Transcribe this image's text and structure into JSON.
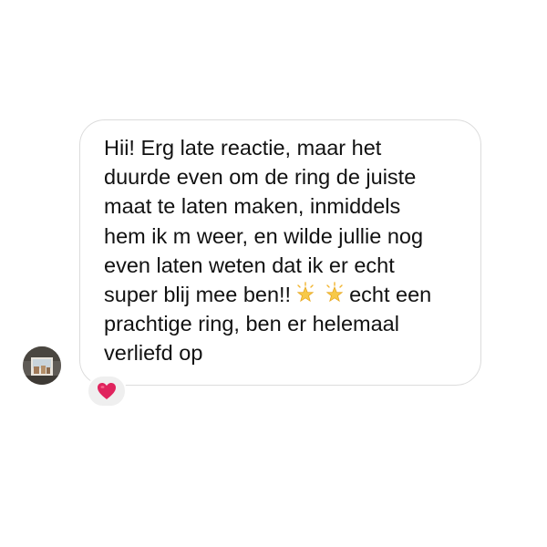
{
  "conversation": {
    "message": {
      "lines": [
        "Hii! Erg late reactie, maar het",
        "duurde even om de ring de juiste",
        "maat te laten maken, inmiddels",
        "hem ik m weer, en wilde jullie nog",
        "even laten weten dat ik er echt"
      ],
      "line6_text_before": "super blij mee ben!!",
      "line6_text_after": "echt een",
      "line7": "prachtige ring, ben er helemaal",
      "line8": "verliefd op",
      "emoji": [
        "star-emoji",
        "star-emoji"
      ]
    },
    "reaction": {
      "emoji": "heart-emoji",
      "color": "#e0245e"
    },
    "sender_avatar_icon": "avatar-photo"
  }
}
